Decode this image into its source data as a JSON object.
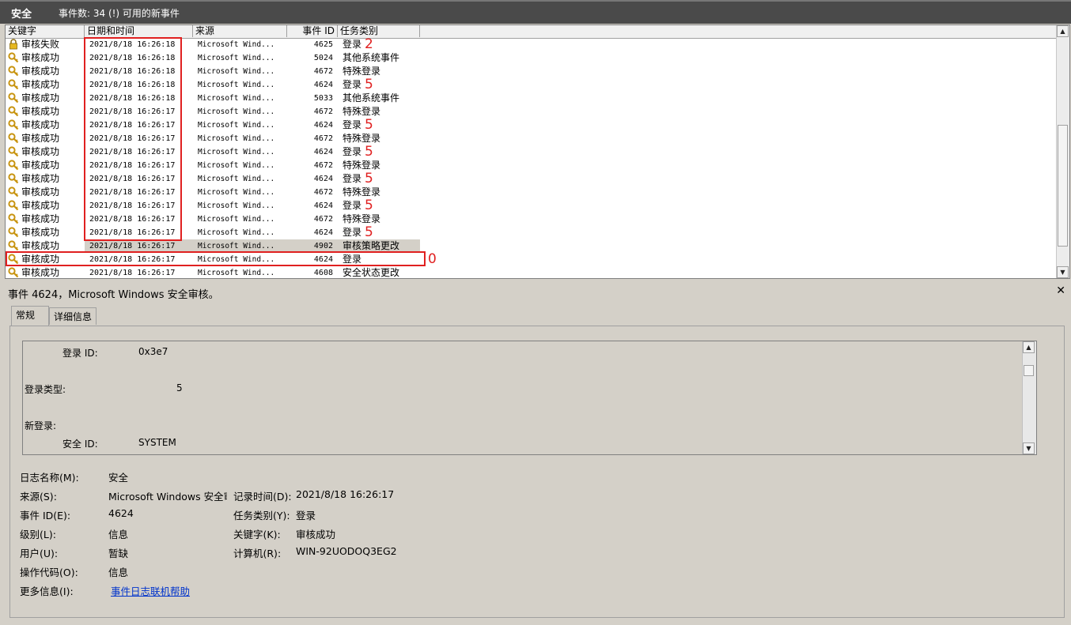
{
  "window": {
    "title": "安全",
    "event_count_text": "事件数: 34 (!) 可用的新事件"
  },
  "columns": {
    "keyword": "关键字",
    "datetime": "日期和时间",
    "source": "来源",
    "event_id": "事件 ID",
    "task": "任务类别"
  },
  "rows": [
    {
      "keyword": "审核失败",
      "icon": "lock-icon",
      "datetime": "2021/8/18 16:26:18",
      "source": "Microsoft Wind...",
      "event_id": "4625",
      "task": "登录",
      "mark": "2"
    },
    {
      "keyword": "审核成功",
      "icon": "key-icon",
      "datetime": "2021/8/18 16:26:18",
      "source": "Microsoft Wind...",
      "event_id": "5024",
      "task": "其他系统事件",
      "mark": ""
    },
    {
      "keyword": "审核成功",
      "icon": "key-icon",
      "datetime": "2021/8/18 16:26:18",
      "source": "Microsoft Wind...",
      "event_id": "4672",
      "task": "特殊登录",
      "mark": ""
    },
    {
      "keyword": "审核成功",
      "icon": "key-icon",
      "datetime": "2021/8/18 16:26:18",
      "source": "Microsoft Wind...",
      "event_id": "4624",
      "task": "登录",
      "mark": "5"
    },
    {
      "keyword": "审核成功",
      "icon": "key-icon",
      "datetime": "2021/8/18 16:26:18",
      "source": "Microsoft Wind...",
      "event_id": "5033",
      "task": "其他系统事件",
      "mark": ""
    },
    {
      "keyword": "审核成功",
      "icon": "key-icon",
      "datetime": "2021/8/18 16:26:17",
      "source": "Microsoft Wind...",
      "event_id": "4672",
      "task": "特殊登录",
      "mark": ""
    },
    {
      "keyword": "审核成功",
      "icon": "key-icon",
      "datetime": "2021/8/18 16:26:17",
      "source": "Microsoft Wind...",
      "event_id": "4624",
      "task": "登录",
      "mark": "5"
    },
    {
      "keyword": "审核成功",
      "icon": "key-icon",
      "datetime": "2021/8/18 16:26:17",
      "source": "Microsoft Wind...",
      "event_id": "4672",
      "task": "特殊登录",
      "mark": ""
    },
    {
      "keyword": "审核成功",
      "icon": "key-icon",
      "datetime": "2021/8/18 16:26:17",
      "source": "Microsoft Wind...",
      "event_id": "4624",
      "task": "登录",
      "mark": "5"
    },
    {
      "keyword": "审核成功",
      "icon": "key-icon",
      "datetime": "2021/8/18 16:26:17",
      "source": "Microsoft Wind...",
      "event_id": "4672",
      "task": "特殊登录",
      "mark": ""
    },
    {
      "keyword": "审核成功",
      "icon": "key-icon",
      "datetime": "2021/8/18 16:26:17",
      "source": "Microsoft Wind...",
      "event_id": "4624",
      "task": "登录",
      "mark": "5"
    },
    {
      "keyword": "审核成功",
      "icon": "key-icon",
      "datetime": "2021/8/18 16:26:17",
      "source": "Microsoft Wind...",
      "event_id": "4672",
      "task": "特殊登录",
      "mark": ""
    },
    {
      "keyword": "审核成功",
      "icon": "key-icon",
      "datetime": "2021/8/18 16:26:17",
      "source": "Microsoft Wind...",
      "event_id": "4624",
      "task": "登录",
      "mark": "5"
    },
    {
      "keyword": "审核成功",
      "icon": "key-icon",
      "datetime": "2021/8/18 16:26:17",
      "source": "Microsoft Wind...",
      "event_id": "4672",
      "task": "特殊登录",
      "mark": ""
    },
    {
      "keyword": "审核成功",
      "icon": "key-icon",
      "datetime": "2021/8/18 16:26:17",
      "source": "Microsoft Wind...",
      "event_id": "4624",
      "task": "登录",
      "mark": "5"
    },
    {
      "keyword": "审核成功",
      "icon": "key-icon",
      "datetime": "2021/8/18 16:26:17",
      "source": "Microsoft Wind...",
      "event_id": "4902",
      "task": "审核策略更改",
      "mark": ""
    },
    {
      "keyword": "审核成功",
      "icon": "key-icon",
      "datetime": "2021/8/18 16:26:17",
      "source": "Microsoft Wind...",
      "event_id": "4624",
      "task": "登录",
      "mark": "0"
    },
    {
      "keyword": "审核成功",
      "icon": "key-icon",
      "datetime": "2021/8/18 16:26:17",
      "source": "Microsoft Wind...",
      "event_id": "4608",
      "task": "安全状态更改",
      "mark": ""
    }
  ],
  "detail": {
    "header": "事件 4624，Microsoft Windows 安全审核。",
    "tabs": [
      {
        "label": "常规"
      },
      {
        "label": "详细信息"
      }
    ],
    "description": [
      {
        "label": "登录 ID:",
        "value": "0x3e7"
      },
      {
        "label": "登录类型:",
        "value": "5"
      },
      {
        "label": "新登录:",
        "value": ""
      },
      {
        "label": "安全 ID:",
        "value": "SYSTEM"
      }
    ],
    "props": {
      "log_name_label": "日志名称(M):",
      "log_name": "安全",
      "source_label": "来源(S):",
      "source": "Microsoft Windows 安全审",
      "logged_label": "记录时间(D):",
      "logged": "2021/8/18 16:26:17",
      "event_id_label": "事件 ID(E):",
      "event_id": "4624",
      "task_label": "任务类别(Y):",
      "task": "登录",
      "level_label": "级别(L):",
      "level": "信息",
      "keywords_label": "关键字(K):",
      "keywords": "审核成功",
      "user_label": "用户(U):",
      "user": "暂缺",
      "computer_label": "计算机(R):",
      "computer": "WIN-92UODOQ3EG2",
      "opcode_label": "操作代码(O):",
      "opcode": "信息",
      "more_info_label": "更多信息(I):",
      "more_info_link": "事件日志联机帮助"
    }
  },
  "colors": {
    "annotation": "#e02020",
    "link": "#0033cc"
  }
}
